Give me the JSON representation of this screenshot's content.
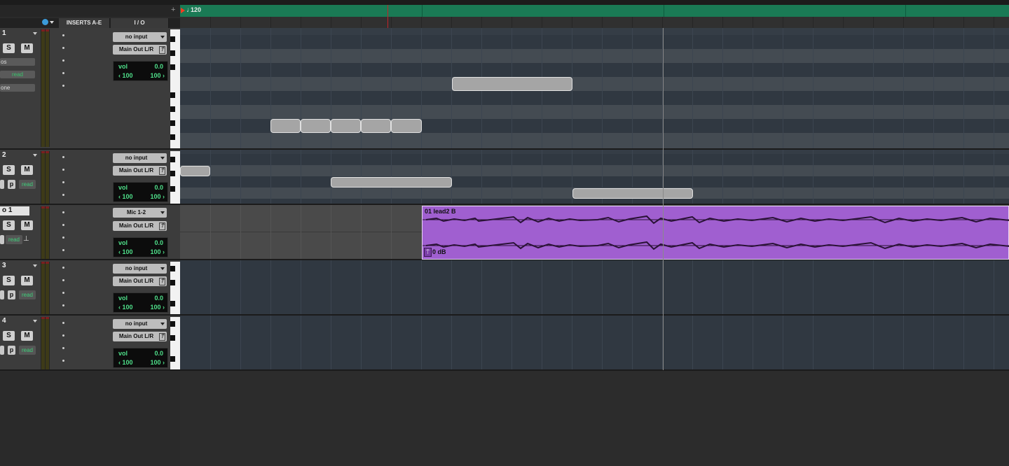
{
  "tempo": {
    "value": "120"
  },
  "headers": {
    "inserts": "INSERTS A-E",
    "io": "I / O"
  },
  "tracks": [
    {
      "name": "1",
      "solo": "S",
      "mute": "M",
      "input": "no input",
      "output": "Main Out L/R",
      "vol_label": "vol",
      "vol": "0.0",
      "pan_l": "‹ 100",
      "pan_r": "100 ›",
      "dropdown1": "os",
      "automation": "read",
      "dropdown3": "one"
    },
    {
      "name": "2",
      "solo": "S",
      "mute": "M",
      "input": "no input",
      "output": "Main Out L/R",
      "vol_label": "vol",
      "vol": "0.0",
      "pan_l": "‹ 100",
      "pan_r": "100 ›",
      "p": "p",
      "automation": "read"
    },
    {
      "name": "o 1",
      "solo": "S",
      "mute": "M",
      "input": "Mic 1-2",
      "output": "Main Out L/R",
      "vol_label": "vol",
      "vol": "0.0",
      "pan_l": "‹ 100",
      "pan_r": "100 ›",
      "automation": "read"
    },
    {
      "name": "3",
      "solo": "S",
      "mute": "M",
      "input": "no input",
      "output": "Main Out L/R",
      "vol_label": "vol",
      "vol": "0.0",
      "pan_l": "‹ 100",
      "pan_r": "100 ›",
      "p": "p",
      "automation": "read"
    },
    {
      "name": "4",
      "solo": "S",
      "mute": "M",
      "input": "no input",
      "output": "Main Out L/R",
      "vol_label": "vol",
      "vol": "0.0",
      "pan_l": "‹ 100",
      "pan_r": "100 ›",
      "p": "p",
      "automation": "read"
    }
  ],
  "clip": {
    "name": "01 lead2 B",
    "gain": "0 dB"
  },
  "colors": {
    "tempo_bar": "#1a7a55",
    "clip": "#a05fd0",
    "meter_text": "#4fe08a",
    "playhead_marker": "#c0242a"
  },
  "icons": [
    "plus-icon",
    "clock-icon",
    "tempo-flag-icon",
    "output-lock-icon",
    "clip-gain-icon"
  ]
}
